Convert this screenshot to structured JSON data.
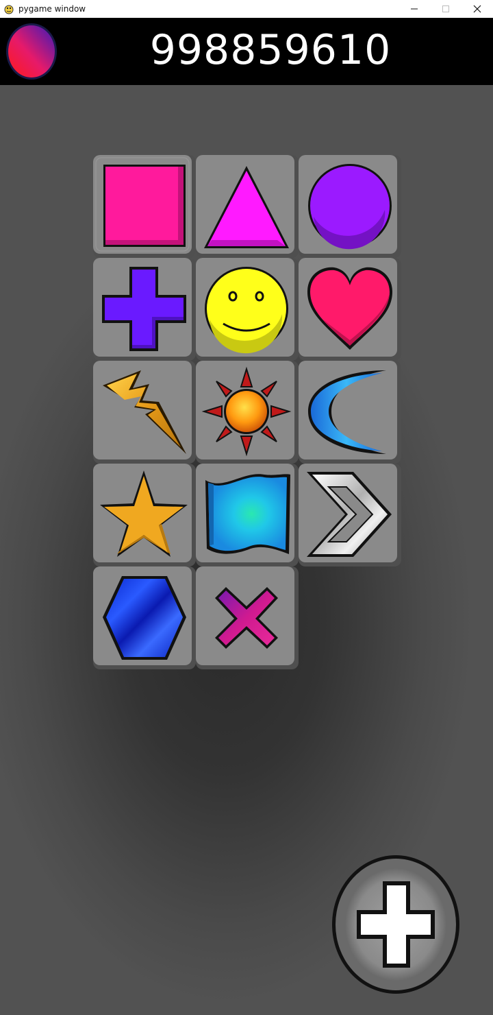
{
  "window": {
    "title": "pygame window"
  },
  "header": {
    "score": "998859610"
  },
  "colors": {
    "board_background": "#4a4a4a",
    "header_background": "#000000",
    "tile_face": "#8a8a8a",
    "tile_shadow": "#4f4f4f"
  },
  "tiles": [
    {
      "row": 1,
      "col": 1,
      "icon": "pink-square-icon",
      "color": "#ff1a9c"
    },
    {
      "row": 1,
      "col": 2,
      "icon": "magenta-triangle-icon",
      "color": "#ff1aff"
    },
    {
      "row": 1,
      "col": 3,
      "icon": "purple-circle-icon",
      "color": "#9b1aff"
    },
    {
      "row": 2,
      "col": 1,
      "icon": "purple-plus-icon",
      "color": "#6a1aff"
    },
    {
      "row": 2,
      "col": 2,
      "icon": "smiley-face-icon",
      "color": "#ffff1a"
    },
    {
      "row": 2,
      "col": 3,
      "icon": "heart-icon",
      "color": "#ff1a6a"
    },
    {
      "row": 3,
      "col": 1,
      "icon": "lightning-bolt-icon",
      "color": "#e6a020"
    },
    {
      "row": 3,
      "col": 2,
      "icon": "sun-icon",
      "color": "#ff9a10"
    },
    {
      "row": 3,
      "col": 3,
      "icon": "crescent-moon-icon",
      "color": "#2a9de6"
    },
    {
      "row": 4,
      "col": 1,
      "icon": "star-icon",
      "color": "#f0a820"
    },
    {
      "row": 4,
      "col": 2,
      "icon": "flag-icon",
      "color": "#20b8f0"
    },
    {
      "row": 4,
      "col": 3,
      "icon": "chevron-right-icon",
      "color": "#d0d0d0"
    },
    {
      "row": 5,
      "col": 1,
      "icon": "hexagon-icon",
      "color": "#1a3aff"
    },
    {
      "row": 5,
      "col": 2,
      "icon": "x-cross-icon",
      "color": "#c01a80"
    }
  ],
  "add_button": {
    "icon": "plus-icon"
  }
}
